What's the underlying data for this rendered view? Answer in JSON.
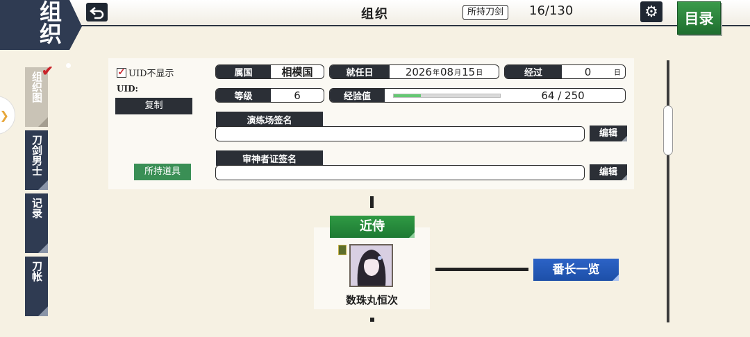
{
  "header": {
    "corner_title": "组织",
    "title": "组织",
    "owned_label": "所持刀剑",
    "owned_count": "16/130",
    "menu_label": "目录"
  },
  "sidebar": {
    "tabs": [
      {
        "label": "组织图",
        "active": true
      },
      {
        "label": "刀剑男士",
        "active": false
      },
      {
        "label": "记录",
        "active": false
      },
      {
        "label": "刀帐",
        "active": false
      }
    ]
  },
  "profile": {
    "uid_hide_label": "UID不显示",
    "uid_hide_checked": true,
    "uid_label": "UID:",
    "copy_label": "复制",
    "items_label": "所持道具",
    "country_label": "属国",
    "country_value": "相模国",
    "appointed_label": "就任日",
    "appointed_year": "2026",
    "appointed_year_unit": "年",
    "appointed_month": "08",
    "appointed_month_unit": "月",
    "appointed_day": "15",
    "appointed_day_unit": "日",
    "elapsed_label": "经过",
    "elapsed_value": "0",
    "elapsed_unit": "日",
    "level_label": "等级",
    "level_value": "6",
    "exp_label": "经验值",
    "exp_value": "64 / 250",
    "exp_fraction": 0.256,
    "training_sign_label": "演练场签名",
    "training_sign_value": "",
    "examiner_sign_label": "审神者证签名",
    "examiner_sign_value": "",
    "edit_label": "编辑"
  },
  "org": {
    "attendant_label": "近侍",
    "attendant_name": "数珠丸恒次",
    "captains_label": "番长一览"
  },
  "colors": {
    "navy": "#2f3b52",
    "green": "#2f9a44",
    "blue": "#2c63c6",
    "background": "#f6f1e3"
  }
}
